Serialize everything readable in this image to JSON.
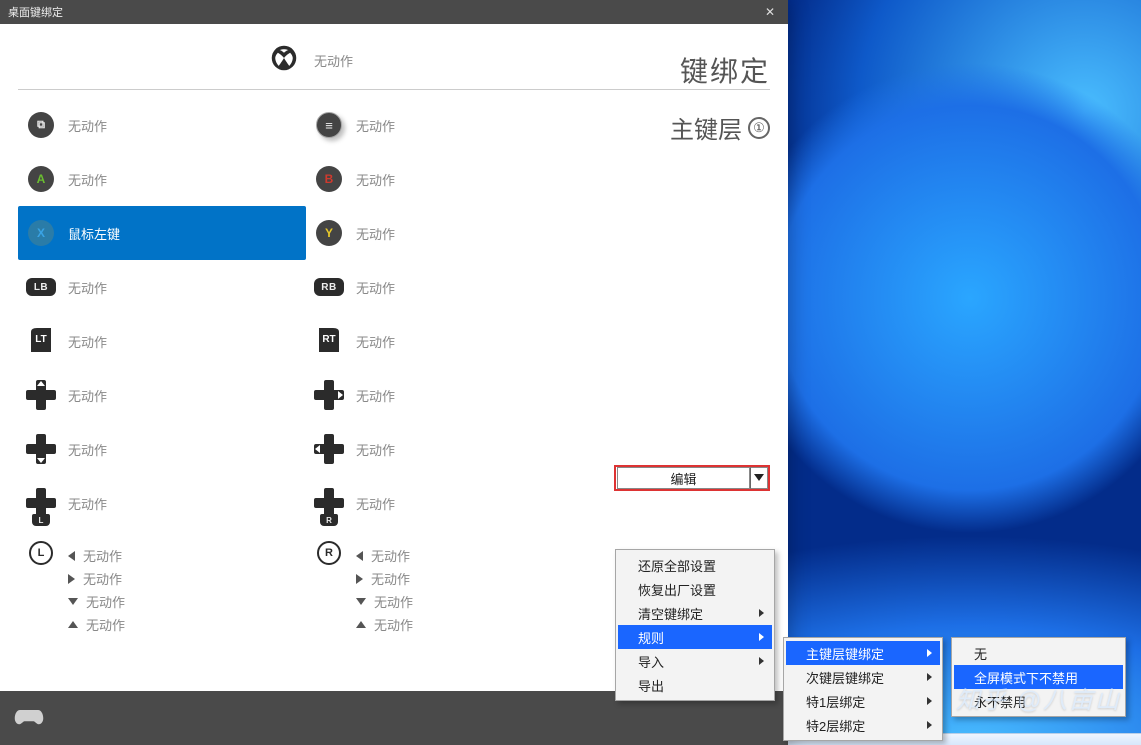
{
  "window": {
    "title": "桌面键绑定",
    "close": "✕"
  },
  "header": {
    "xbox_action": "无动作",
    "right_title": "键绑定",
    "right_sub": "主键层",
    "layer_num": "①"
  },
  "noact": "无动作",
  "rows": {
    "view": {
      "label": "无动作"
    },
    "menu": {
      "label": "无动作"
    },
    "a": {
      "letter": "A",
      "label": "无动作"
    },
    "b": {
      "letter": "B",
      "label": "无动作"
    },
    "x": {
      "letter": "X",
      "label": "鼠标左键"
    },
    "y": {
      "letter": "Y",
      "label": "无动作"
    },
    "lb": {
      "letter": "LB",
      "label": "无动作"
    },
    "rb": {
      "letter": "RB",
      "label": "无动作"
    },
    "lt": {
      "letter": "LT",
      "label": "无动作"
    },
    "rt": {
      "letter": "RT",
      "label": "无动作"
    },
    "dpad_up": {
      "label": "无动作"
    },
    "dpad_rt": {
      "label": "无动作"
    },
    "dpad_dn": {
      "label": "无动作"
    },
    "dpad_lf": {
      "label": "无动作"
    },
    "dpad_l": {
      "letter": "L",
      "label": "无动作"
    },
    "dpad_r": {
      "letter": "R",
      "label": "无动作"
    },
    "lstick": {
      "letter": "L"
    },
    "rstick": {
      "letter": "R"
    }
  },
  "stick_dirs": {
    "left": "无动作",
    "right": "无动作",
    "down": "无动作",
    "up": "无动作"
  },
  "edit_button": {
    "label": "编辑"
  },
  "menu1": {
    "restore_all": "还原全部设置",
    "factory": "恢复出厂设置",
    "clear_bind": "清空键绑定",
    "rules": "规则",
    "import": "导入",
    "export": "导出"
  },
  "menu2": {
    "primary": "主键层键绑定",
    "secondary": "次键层键绑定",
    "special1": "特1层绑定",
    "special2": "特2层绑定"
  },
  "menu3": {
    "none": "无",
    "fullscreen_no_disable": "全屏模式下不禁用",
    "always_disable": "永不禁用"
  },
  "watermark": "知乎 @八亩山"
}
